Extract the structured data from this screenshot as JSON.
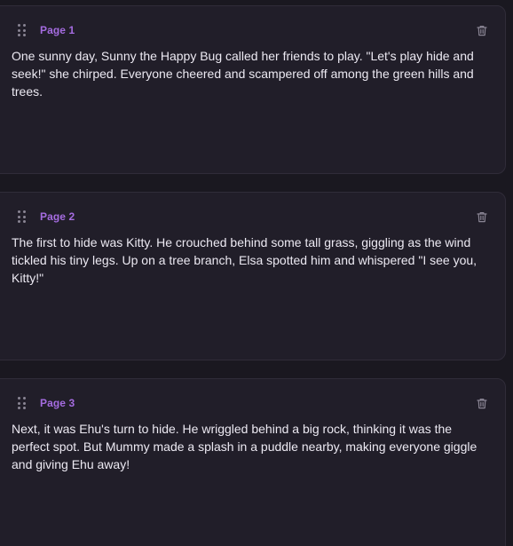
{
  "pages": [
    {
      "label": "Page 1",
      "text": "One sunny day, Sunny the Happy Bug called her friends to play. \"Let's play hide and seek!\" she chirped. Everyone cheered and scampered off among the green hills and trees."
    },
    {
      "label": "Page 2",
      "text": "The first to hide was Kitty. He crouched behind some tall grass, giggling as the wind tickled his tiny legs. Up on a tree branch, Elsa spotted him and whispered \"I see you, Kitty!\""
    },
    {
      "label": "Page 3",
      "text": "Next, it was Ehu's turn to hide. He wriggled behind a big rock, thinking it was the perfect spot. But Mummy made a splash in a puddle nearby, making everyone giggle and giving Ehu away!"
    }
  ],
  "icons": {
    "drag": "drag-handle-icon",
    "delete": "trash-icon"
  },
  "colors": {
    "background": "#1a1820",
    "card": "#211e29",
    "label_accent": "#a56ce0",
    "text": "#ece9f2",
    "icon": "#8a8594"
  }
}
